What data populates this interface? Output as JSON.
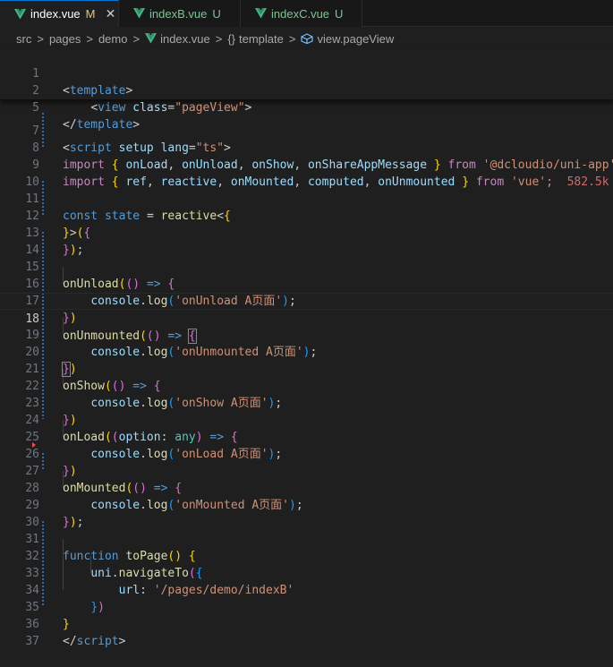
{
  "tabs": [
    {
      "label": "index.vue",
      "status": "M",
      "close": "✕",
      "active": true
    },
    {
      "label": "indexB.vue",
      "status": "U",
      "active": false
    },
    {
      "label": "indexC.vue",
      "status": "U",
      "active": false
    }
  ],
  "breadcrumb": {
    "items": [
      "src",
      "pages",
      "demo",
      "index.vue",
      "template",
      "view.pageView"
    ],
    "separator": ">",
    "template_icon": "{}"
  },
  "editor": {
    "line_numbers": [
      "1",
      "2",
      "5",
      "7",
      "8",
      "9",
      "10",
      "11",
      "12",
      "13",
      "14",
      "15",
      "16",
      "17",
      "18",
      "19",
      "20",
      "21",
      "22",
      "23",
      "24",
      "25",
      "26",
      "27",
      "28",
      "29",
      "30",
      "31",
      "32",
      "33",
      "34",
      "35",
      "36",
      "37"
    ],
    "current_line": "18",
    "code": {
      "l1_template": "template",
      "l2_view": "view",
      "l2_class": "class",
      "l2_value": "\"pageView\"",
      "l5_template": "template",
      "l7_script": "script",
      "l7_setup": "setup",
      "l7_lang": "lang",
      "l7_ts": "\"ts\"",
      "import": "import",
      "from": "from",
      "l8_names": "onLoad, onUnload, onShow, onShareAppMessage",
      "l8_n1": "onLoad",
      "l8_n2": "onUnload",
      "l8_n3": "onShow",
      "l8_n4": "onShareAppMessage",
      "l8_src": "'@dcloudio/uni-app';",
      "l9_n1": "ref",
      "l9_n2": "reactive",
      "l9_n3": "onMounted",
      "l9_n4": "computed",
      "l9_n5": "onUnmounted",
      "l9_src": "'vue';",
      "l9_size": "582.5k (",
      "l11_const": "const",
      "l11_state": "state",
      "l11_reactive": "reactive",
      "onUnload": "onUnload",
      "onUnmounted": "onUnmounted",
      "onShow": "onShow",
      "onLoad": "onLoad",
      "onMounted": "onMounted",
      "console": "console",
      "log": "log",
      "s16": "'onUnload A页面'",
      "s19": "'onUnmounted A页面'",
      "s22": "'onShow A页面'",
      "s25": "'onLoad A页面'",
      "s28": "'onMounted A页面'",
      "option": "option",
      "any": "any",
      "function_kw": "function",
      "toPage": "toPage",
      "uni": "uni",
      "navigateTo": "navigateTo",
      "url": "url",
      "url_value": "'/pages/demo/indexB'",
      "l36_script": "script"
    }
  },
  "colors": {
    "background": "#1f1f1f",
    "keyword_blue": "#569cd6",
    "string": "#ce9178",
    "import_purple": "#c586c0",
    "function_yellow": "#dcdcaa",
    "modified": "#e2c08d",
    "untracked": "#73c991"
  }
}
